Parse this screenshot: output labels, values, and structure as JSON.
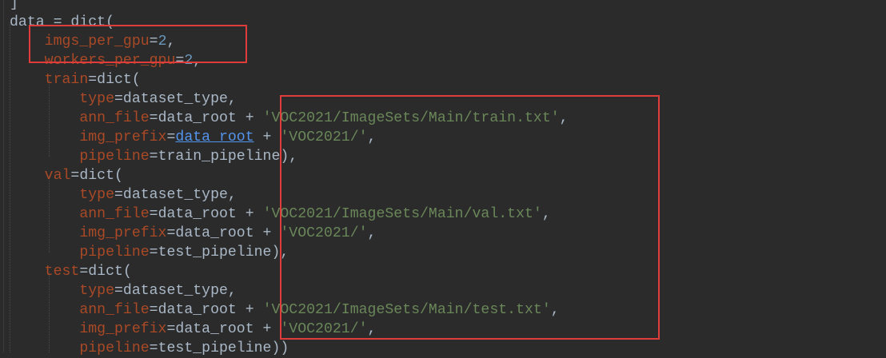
{
  "editor": {
    "lines": [
      {
        "indent": "",
        "tokens": [
          {
            "t": "]",
            "c": "op"
          }
        ]
      },
      {
        "indent": "",
        "tokens": [
          {
            "t": "data",
            "c": "op"
          },
          {
            "t": " = ",
            "c": "op"
          },
          {
            "t": "dict",
            "c": "op"
          },
          {
            "t": "(",
            "c": "op"
          }
        ]
      },
      {
        "indent": "    ",
        "tokens": [
          {
            "t": "imgs_per_gpu",
            "c": "kw"
          },
          {
            "t": "=",
            "c": "op"
          },
          {
            "t": "2",
            "c": "num"
          },
          {
            "t": ",",
            "c": "op"
          }
        ]
      },
      {
        "indent": "    ",
        "tokens": [
          {
            "t": "workers_per_gpu",
            "c": "kw"
          },
          {
            "t": "=",
            "c": "op"
          },
          {
            "t": "2",
            "c": "num"
          },
          {
            "t": ",",
            "c": "op"
          }
        ]
      },
      {
        "indent": "    ",
        "tokens": [
          {
            "t": "train",
            "c": "kw"
          },
          {
            "t": "=",
            "c": "op"
          },
          {
            "t": "dict",
            "c": "op"
          },
          {
            "t": "(",
            "c": "op"
          }
        ]
      },
      {
        "indent": "        ",
        "tokens": [
          {
            "t": "type",
            "c": "kw"
          },
          {
            "t": "=",
            "c": "op"
          },
          {
            "t": "dataset_type",
            "c": "op"
          },
          {
            "t": ",",
            "c": "op"
          }
        ]
      },
      {
        "indent": "        ",
        "tokens": [
          {
            "t": "ann_file",
            "c": "kw"
          },
          {
            "t": "=",
            "c": "op"
          },
          {
            "t": "data_root",
            "c": "op"
          },
          {
            "t": " + ",
            "c": "op"
          },
          {
            "t": "'VOC2021/ImageSets/Main/train.txt'",
            "c": "str"
          },
          {
            "t": ",",
            "c": "op"
          }
        ]
      },
      {
        "indent": "        ",
        "tokens": [
          {
            "t": "img_prefix",
            "c": "kw"
          },
          {
            "t": "=",
            "c": "op"
          },
          {
            "t": "data_root",
            "c": "link"
          },
          {
            "t": " + ",
            "c": "op"
          },
          {
            "t": "'VOC2021/'",
            "c": "str"
          },
          {
            "t": ",",
            "c": "op"
          }
        ]
      },
      {
        "indent": "        ",
        "tokens": [
          {
            "t": "pipeline",
            "c": "kw"
          },
          {
            "t": "=",
            "c": "op"
          },
          {
            "t": "train_pipeline",
            "c": "op"
          },
          {
            "t": "),",
            "c": "op"
          }
        ]
      },
      {
        "indent": "    ",
        "tokens": [
          {
            "t": "val",
            "c": "kw"
          },
          {
            "t": "=",
            "c": "op"
          },
          {
            "t": "dict",
            "c": "op"
          },
          {
            "t": "(",
            "c": "op"
          }
        ]
      },
      {
        "indent": "        ",
        "tokens": [
          {
            "t": "type",
            "c": "kw"
          },
          {
            "t": "=",
            "c": "op"
          },
          {
            "t": "dataset_type",
            "c": "op"
          },
          {
            "t": ",",
            "c": "op"
          }
        ]
      },
      {
        "indent": "        ",
        "tokens": [
          {
            "t": "ann_file",
            "c": "kw"
          },
          {
            "t": "=",
            "c": "op"
          },
          {
            "t": "data_root",
            "c": "op"
          },
          {
            "t": " + ",
            "c": "op"
          },
          {
            "t": "'VOC2021/ImageSets/Main/val.txt'",
            "c": "str"
          },
          {
            "t": ",",
            "c": "op"
          }
        ]
      },
      {
        "indent": "        ",
        "tokens": [
          {
            "t": "img_prefix",
            "c": "kw"
          },
          {
            "t": "=",
            "c": "op"
          },
          {
            "t": "data_root",
            "c": "op"
          },
          {
            "t": " + ",
            "c": "op"
          },
          {
            "t": "'VOC2021/'",
            "c": "str"
          },
          {
            "t": ",",
            "c": "op"
          }
        ]
      },
      {
        "indent": "        ",
        "tokens": [
          {
            "t": "pipeline",
            "c": "kw"
          },
          {
            "t": "=",
            "c": "op"
          },
          {
            "t": "test_pipeline",
            "c": "op"
          },
          {
            "t": "),",
            "c": "op"
          }
        ]
      },
      {
        "indent": "    ",
        "tokens": [
          {
            "t": "test",
            "c": "kw"
          },
          {
            "t": "=",
            "c": "op"
          },
          {
            "t": "dict",
            "c": "op"
          },
          {
            "t": "(",
            "c": "op"
          }
        ]
      },
      {
        "indent": "        ",
        "tokens": [
          {
            "t": "type",
            "c": "kw"
          },
          {
            "t": "=",
            "c": "op"
          },
          {
            "t": "dataset_type",
            "c": "op"
          },
          {
            "t": ",",
            "c": "op"
          }
        ]
      },
      {
        "indent": "        ",
        "tokens": [
          {
            "t": "ann_file",
            "c": "kw"
          },
          {
            "t": "=",
            "c": "op"
          },
          {
            "t": "data_root",
            "c": "op"
          },
          {
            "t": " + ",
            "c": "op"
          },
          {
            "t": "'VOC2021/ImageSets/Main/test.txt'",
            "c": "str"
          },
          {
            "t": ",",
            "c": "op"
          }
        ]
      },
      {
        "indent": "        ",
        "tokens": [
          {
            "t": "img_prefix",
            "c": "kw"
          },
          {
            "t": "=",
            "c": "op"
          },
          {
            "t": "data_root",
            "c": "op"
          },
          {
            "t": " + ",
            "c": "op"
          },
          {
            "t": "'VOC2021/'",
            "c": "str"
          },
          {
            "t": ",",
            "c": "op"
          }
        ]
      },
      {
        "indent": "        ",
        "tokens": [
          {
            "t": "pipeline",
            "c": "kw"
          },
          {
            "t": "=",
            "c": "op"
          },
          {
            "t": "test_pipeline",
            "c": "op"
          },
          {
            "t": "))",
            "c": "op"
          }
        ]
      }
    ]
  },
  "colors": {
    "background": "#2b2b2b",
    "keyword_arg": "#aa4926",
    "plain": "#a9b7c6",
    "number": "#6897bb",
    "string": "#6a8759",
    "link": "#5394ec",
    "highlight_box": "#e03c3c"
  }
}
